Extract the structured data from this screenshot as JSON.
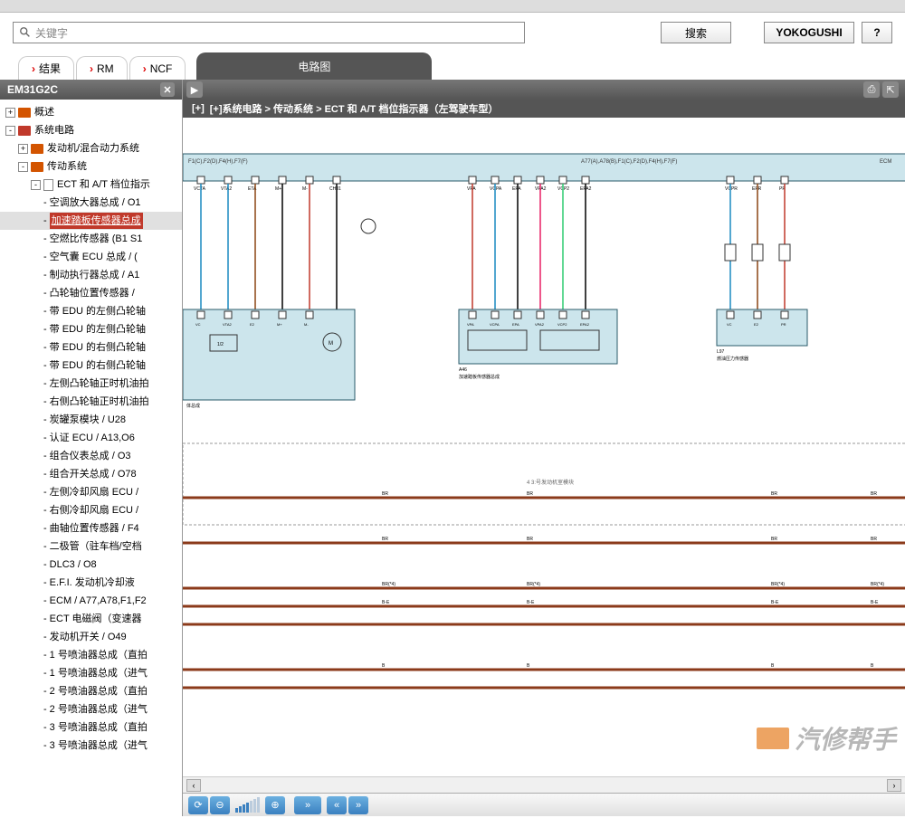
{
  "search": {
    "placeholder": "关键字",
    "search_btn": "搜索",
    "yoko_btn": "YOKOGUSHI",
    "help": "?"
  },
  "tabs": {
    "result": "结果",
    "rm": "RM",
    "ncf": "NCF",
    "circuit": "电路图"
  },
  "sidebar": {
    "header": "EM31G2C",
    "items": [
      {
        "lv": 1,
        "exp": "+",
        "icon": "book",
        "label": "概述"
      },
      {
        "lv": 1,
        "exp": "-",
        "icon": "book-red",
        "label": "系统电路"
      },
      {
        "lv": 2,
        "exp": "+",
        "icon": "book",
        "label": "发动机/混合动力系统"
      },
      {
        "lv": 2,
        "exp": "-",
        "icon": "book",
        "label": "传动系统"
      },
      {
        "lv": 3,
        "exp": "-",
        "icon": "doc",
        "label": "ECT 和 A/T 档位指示"
      },
      {
        "lv": 4,
        "dash": true,
        "label": "空调放大器总成 / O1"
      },
      {
        "lv": 4,
        "dash": true,
        "label": "加速踏板传感器总成",
        "selected": true
      },
      {
        "lv": 4,
        "dash": true,
        "label": "空燃比传感器 (B1 S1"
      },
      {
        "lv": 4,
        "dash": true,
        "label": "空气囊 ECU 总成 / ("
      },
      {
        "lv": 4,
        "dash": true,
        "label": "制动执行器总成 / A1"
      },
      {
        "lv": 4,
        "dash": true,
        "label": "凸轮轴位置传感器 /"
      },
      {
        "lv": 4,
        "dash": true,
        "label": "带 EDU 的左侧凸轮轴"
      },
      {
        "lv": 4,
        "dash": true,
        "label": "带 EDU 的左侧凸轮轴"
      },
      {
        "lv": 4,
        "dash": true,
        "label": "带 EDU 的右侧凸轮轴"
      },
      {
        "lv": 4,
        "dash": true,
        "label": "带 EDU 的右侧凸轮轴"
      },
      {
        "lv": 4,
        "dash": true,
        "label": "左侧凸轮轴正时机油拍"
      },
      {
        "lv": 4,
        "dash": true,
        "label": "右侧凸轮轴正时机油拍"
      },
      {
        "lv": 4,
        "dash": true,
        "label": "炭罐泵模块 / U28"
      },
      {
        "lv": 4,
        "dash": true,
        "label": "认证 ECU / A13,O6"
      },
      {
        "lv": 4,
        "dash": true,
        "label": "组合仪表总成 / O3"
      },
      {
        "lv": 4,
        "dash": true,
        "label": "组合开关总成 / O78"
      },
      {
        "lv": 4,
        "dash": true,
        "label": "左侧冷却风扇 ECU /"
      },
      {
        "lv": 4,
        "dash": true,
        "label": "右侧冷却风扇 ECU /"
      },
      {
        "lv": 4,
        "dash": true,
        "label": "曲轴位置传感器 / F4"
      },
      {
        "lv": 4,
        "dash": true,
        "label": "二极管（驻车档/空档"
      },
      {
        "lv": 4,
        "dash": true,
        "label": "DLC3 / O8"
      },
      {
        "lv": 4,
        "dash": true,
        "label": "E.F.I. 发动机冷却液"
      },
      {
        "lv": 4,
        "dash": true,
        "label": "ECM / A77,A78,F1,F2"
      },
      {
        "lv": 4,
        "dash": true,
        "label": "ECT 电磁阀（变速器"
      },
      {
        "lv": 4,
        "dash": true,
        "label": "发动机开关 / O49"
      },
      {
        "lv": 4,
        "dash": true,
        "label": "1 号喷油器总成（直拍"
      },
      {
        "lv": 4,
        "dash": true,
        "label": "1 号喷油器总成（进气"
      },
      {
        "lv": 4,
        "dash": true,
        "label": "2 号喷油器总成（直拍"
      },
      {
        "lv": 4,
        "dash": true,
        "label": "2 号喷油器总成（进气"
      },
      {
        "lv": 4,
        "dash": true,
        "label": "3 号喷油器总成（直拍"
      },
      {
        "lv": 4,
        "dash": true,
        "label": "3 号喷油器总成（进气"
      }
    ]
  },
  "content": {
    "title": "[+]系统电路 > 传动系统 > ECT 和 A/T 档位指示器（左驾驶车型）"
  },
  "diagram": {
    "ecm_left": "F1(C),F2(D),F4(H),F7(F)",
    "ecm_right": "A77(A),A78(B),F1(C),F2(D),F4(H),F7(F)",
    "ecm_label": "ECM",
    "pins_left": [
      "VCTA",
      "VTA2",
      "ETA",
      "M+",
      "M-",
      "CH01"
    ],
    "pins_mid": [
      "VPA",
      "VCPA",
      "EPA",
      "VPA2",
      "VCP2",
      "EPA2"
    ],
    "pins_right": [
      "VCPR",
      "EPR",
      "PR"
    ],
    "module_left": "体总成",
    "module_mid": "加速踏板传感器总成",
    "module_mid_code": "A46",
    "module_right": "燃油压力传感器",
    "module_right_code": "L97",
    "mid_pins": [
      "VPA",
      "VCPA",
      "EPA",
      "VPA2",
      "VCP2",
      "EPA2"
    ],
    "right_pins": [
      "VC",
      "E2",
      "PR"
    ],
    "left_box_pins": [
      "VC",
      "VTA2",
      "E2",
      "M+",
      "M-"
    ],
    "block_label": "4 3:号发动机室模块",
    "bus_labels": [
      "BR",
      "BR(*4)",
      "B-E",
      "B"
    ],
    "watermark": "汽修帮手"
  }
}
